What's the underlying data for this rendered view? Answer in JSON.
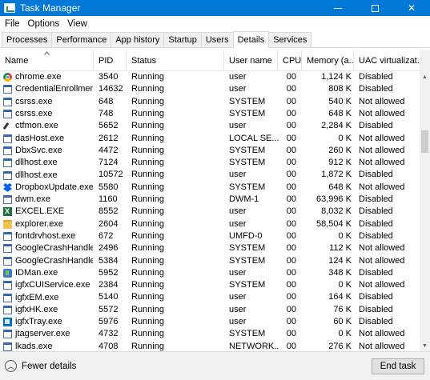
{
  "window": {
    "title": "Task Manager",
    "minimize": "minimize",
    "maximize": "maximize",
    "close": "✕"
  },
  "menu": [
    "File",
    "Options",
    "View"
  ],
  "tabs": [
    "Processes",
    "Performance",
    "App history",
    "Startup",
    "Users",
    "Details",
    "Services"
  ],
  "active_tab": "Details",
  "columns": {
    "name": "Name",
    "pid": "PID",
    "status": "Status",
    "user": "User name",
    "cpu": "CPU",
    "mem": "Memory (a...",
    "uac": "UAC virtualizat..."
  },
  "rows": [
    {
      "name": "chrome.exe",
      "icon": "chrome-icon",
      "pid": "3540",
      "status": "Running",
      "user": "user",
      "cpu": "00",
      "mem": "1,124 K",
      "uac": "Disabled"
    },
    {
      "name": "CredentialEnrollmen...",
      "icon": "app-icon",
      "pid": "14632",
      "status": "Running",
      "user": "user",
      "cpu": "00",
      "mem": "808 K",
      "uac": "Disabled"
    },
    {
      "name": "csrss.exe",
      "icon": "app-icon",
      "pid": "648",
      "status": "Running",
      "user": "SYSTEM",
      "cpu": "00",
      "mem": "540 K",
      "uac": "Not allowed"
    },
    {
      "name": "csrss.exe",
      "icon": "app-icon",
      "pid": "748",
      "status": "Running",
      "user": "SYSTEM",
      "cpu": "00",
      "mem": "648 K",
      "uac": "Not allowed"
    },
    {
      "name": "ctfmon.exe",
      "icon": "pen-icon",
      "pid": "5652",
      "status": "Running",
      "user": "user",
      "cpu": "00",
      "mem": "2,284 K",
      "uac": "Disabled"
    },
    {
      "name": "dasHost.exe",
      "icon": "app-icon",
      "pid": "2612",
      "status": "Running",
      "user": "LOCAL SE...",
      "cpu": "00",
      "mem": "0 K",
      "uac": "Not allowed"
    },
    {
      "name": "DbxSvc.exe",
      "icon": "app-icon",
      "pid": "4472",
      "status": "Running",
      "user": "SYSTEM",
      "cpu": "00",
      "mem": "260 K",
      "uac": "Not allowed"
    },
    {
      "name": "dllhost.exe",
      "icon": "app-icon",
      "pid": "7124",
      "status": "Running",
      "user": "SYSTEM",
      "cpu": "00",
      "mem": "912 K",
      "uac": "Not allowed"
    },
    {
      "name": "dllhost.exe",
      "icon": "app-icon",
      "pid": "10572",
      "status": "Running",
      "user": "user",
      "cpu": "00",
      "mem": "1,872 K",
      "uac": "Disabled"
    },
    {
      "name": "DropboxUpdate.exe",
      "icon": "dropbox-icon",
      "pid": "5580",
      "status": "Running",
      "user": "SYSTEM",
      "cpu": "00",
      "mem": "648 K",
      "uac": "Not allowed"
    },
    {
      "name": "dwm.exe",
      "icon": "app-icon",
      "pid": "1160",
      "status": "Running",
      "user": "DWM-1",
      "cpu": "00",
      "mem": "63,996 K",
      "uac": "Disabled"
    },
    {
      "name": "EXCEL.EXE",
      "icon": "excel-icon",
      "pid": "8552",
      "status": "Running",
      "user": "user",
      "cpu": "00",
      "mem": "8,032 K",
      "uac": "Disabled"
    },
    {
      "name": "explorer.exe",
      "icon": "folder-icon",
      "pid": "2604",
      "status": "Running",
      "user": "user",
      "cpu": "00",
      "mem": "58,504 K",
      "uac": "Disabled"
    },
    {
      "name": "fontdrvhost.exe",
      "icon": "app-icon",
      "pid": "672",
      "status": "Running",
      "user": "UMFD-0",
      "cpu": "00",
      "mem": "0 K",
      "uac": "Disabled"
    },
    {
      "name": "GoogleCrashHandler...",
      "icon": "app-icon",
      "pid": "2496",
      "status": "Running",
      "user": "SYSTEM",
      "cpu": "00",
      "mem": "112 K",
      "uac": "Not allowed"
    },
    {
      "name": "GoogleCrashHandler...",
      "icon": "app-icon",
      "pid": "5384",
      "status": "Running",
      "user": "SYSTEM",
      "cpu": "00",
      "mem": "124 K",
      "uac": "Not allowed"
    },
    {
      "name": "IDMan.exe",
      "icon": "idman-icon",
      "pid": "5952",
      "status": "Running",
      "user": "user",
      "cpu": "00",
      "mem": "348 K",
      "uac": "Disabled"
    },
    {
      "name": "igfxCUIService.exe",
      "icon": "app-icon",
      "pid": "2384",
      "status": "Running",
      "user": "SYSTEM",
      "cpu": "00",
      "mem": "0 K",
      "uac": "Not allowed"
    },
    {
      "name": "igfxEM.exe",
      "icon": "app-icon",
      "pid": "5140",
      "status": "Running",
      "user": "user",
      "cpu": "00",
      "mem": "164 K",
      "uac": "Disabled"
    },
    {
      "name": "igfxHK.exe",
      "icon": "app-icon",
      "pid": "5572",
      "status": "Running",
      "user": "user",
      "cpu": "00",
      "mem": "76 K",
      "uac": "Disabled"
    },
    {
      "name": "igfxTray.exe",
      "icon": "intel-icon",
      "pid": "5976",
      "status": "Running",
      "user": "user",
      "cpu": "00",
      "mem": "60 K",
      "uac": "Disabled"
    },
    {
      "name": "jtagserver.exe",
      "icon": "app-icon",
      "pid": "4732",
      "status": "Running",
      "user": "SYSTEM",
      "cpu": "00",
      "mem": "0 K",
      "uac": "Not allowed"
    },
    {
      "name": "lkads.exe",
      "icon": "app-icon",
      "pid": "4708",
      "status": "Running",
      "user": "NETWORK...",
      "cpu": "00",
      "mem": "276 K",
      "uac": "Not allowed"
    }
  ],
  "footer": {
    "fewer_details": "Fewer details",
    "end_task": "End task"
  },
  "colors": {
    "titlebar": "#0078d7"
  }
}
